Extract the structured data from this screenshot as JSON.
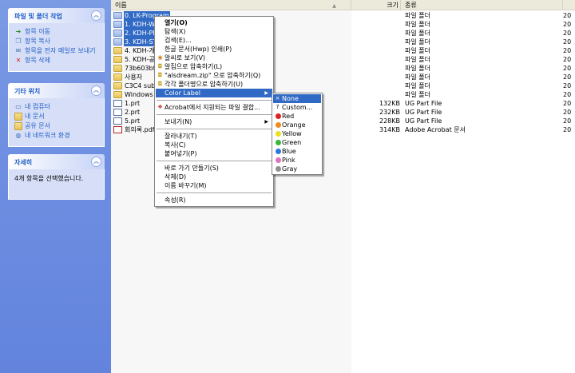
{
  "task_pane": {
    "file_tasks": {
      "title": "파일 및 폴더 작업",
      "items": [
        "항목 이동",
        "항목 복사",
        "항목을 전자 메일로 보내기",
        "항목 삭제"
      ]
    },
    "other_places": {
      "title": "기타 위치",
      "items": [
        "내 컴퓨터",
        "내 문서",
        "공유 문서",
        "내 네트워크 환경"
      ]
    },
    "details": {
      "title": "자세히",
      "text": "4개 항목을 선택했습니다."
    }
  },
  "columns": {
    "name": "이름",
    "size": "크기",
    "type": "종류",
    "date": ""
  },
  "files": [
    {
      "name": "0. LK-Program",
      "size": "",
      "type": "파일 폴더",
      "date": "20",
      "selected": true,
      "icon": "blue-folder-icon"
    },
    {
      "name": "1. KDH-W",
      "size": "",
      "type": "파일 폴더",
      "date": "20",
      "selected": true,
      "icon": "blue-folder-icon"
    },
    {
      "name": "2. KDH-PF",
      "size": "",
      "type": "파일 폴더",
      "date": "20",
      "selected": true,
      "icon": "blue-folder-icon"
    },
    {
      "name": "3. KDH-ST",
      "size": "",
      "type": "파일 폴더",
      "date": "20",
      "selected": true,
      "icon": "blue-folder-icon"
    },
    {
      "name": "4. KDH-개",
      "size": "",
      "type": "파일 폴더",
      "date": "20",
      "selected": false,
      "icon": "folder-icon"
    },
    {
      "name": "5. KDH-공",
      "size": "",
      "type": "파일 폴더",
      "date": "20",
      "selected": false,
      "icon": "folder-icon"
    },
    {
      "name": "73b603bf07",
      "size": "",
      "type": "파일 폴더",
      "date": "20",
      "selected": false,
      "icon": "folder-icon"
    },
    {
      "name": "사용자",
      "size": "",
      "type": "파일 폴더",
      "date": "20",
      "selected": false,
      "icon": "folder-icon"
    },
    {
      "name": "C3C4 sub",
      "size": "",
      "type": "파일 폴더",
      "date": "20",
      "selected": false,
      "icon": "folder-icon"
    },
    {
      "name": "Windows",
      "size": "",
      "type": "파일 폴더",
      "date": "20",
      "selected": false,
      "icon": "folder-icon"
    },
    {
      "name": "1.prt",
      "size": "132KB",
      "type": "UG Part File",
      "date": "20",
      "selected": false,
      "icon": "prt-file-icon"
    },
    {
      "name": "2.prt",
      "size": "232KB",
      "type": "UG Part File",
      "date": "20",
      "selected": false,
      "icon": "prt-file-icon"
    },
    {
      "name": "5.prt",
      "size": "228KB",
      "type": "UG Part File",
      "date": "20",
      "selected": false,
      "icon": "prt-file-icon"
    },
    {
      "name": "회의록.pdf",
      "size": "314KB",
      "type": "Adobe Acrobat 문서",
      "date": "20",
      "selected": false,
      "icon": "pdf-file-icon"
    }
  ],
  "context_menu": {
    "items": [
      {
        "label": "열기(O)",
        "bold": true
      },
      {
        "label": "탐색(X)"
      },
      {
        "label": "검색(E)..."
      },
      {
        "label": "한글 문서(Hwp) 인쇄(P)"
      },
      {
        "label": "알씨로 보기(V)",
        "icon": "alsee-icon"
      },
      {
        "label": "알집으로 압축하기(L)",
        "icon": "alzip-icon"
      },
      {
        "label": "\"alsdream.zip\" 으로 압축하기(Q)",
        "icon": "alzip-icon"
      },
      {
        "label": "각각 폴더명으로 압축하기(U)",
        "icon": "alzip-icon"
      },
      {
        "label": "Color Label",
        "submenu": true,
        "highlighted": true
      },
      {
        "sep": true
      },
      {
        "label": "Acrobat에서 지원되는 파일 결합...",
        "icon": "acrobat-icon"
      },
      {
        "sep": true
      },
      {
        "label": "보내기(N)",
        "submenu": true
      },
      {
        "sep": true
      },
      {
        "label": "잘라내기(T)"
      },
      {
        "label": "복사(C)"
      },
      {
        "label": "붙여넣기(P)"
      },
      {
        "sep": true
      },
      {
        "label": "바로 가기 만들기(S)"
      },
      {
        "label": "삭제(D)"
      },
      {
        "label": "이름 바꾸기(M)"
      },
      {
        "sep": true
      },
      {
        "label": "속성(R)"
      }
    ]
  },
  "color_submenu": {
    "items": [
      {
        "label": "None",
        "marker": "×",
        "highlighted": true
      },
      {
        "label": "Custom...",
        "marker": "?"
      },
      {
        "label": "Red",
        "color": "#e02020"
      },
      {
        "label": "Orange",
        "color": "#f08a18"
      },
      {
        "label": "Yellow",
        "color": "#e8e020"
      },
      {
        "label": "Green",
        "color": "#38b838"
      },
      {
        "label": "Blue",
        "color": "#2878e0"
      },
      {
        "label": "Pink",
        "color": "#e070c0"
      },
      {
        "label": "Gray",
        "color": "#909090"
      }
    ]
  },
  "colors": {
    "selection": "#316ac5",
    "task_link": "#215dc6"
  }
}
